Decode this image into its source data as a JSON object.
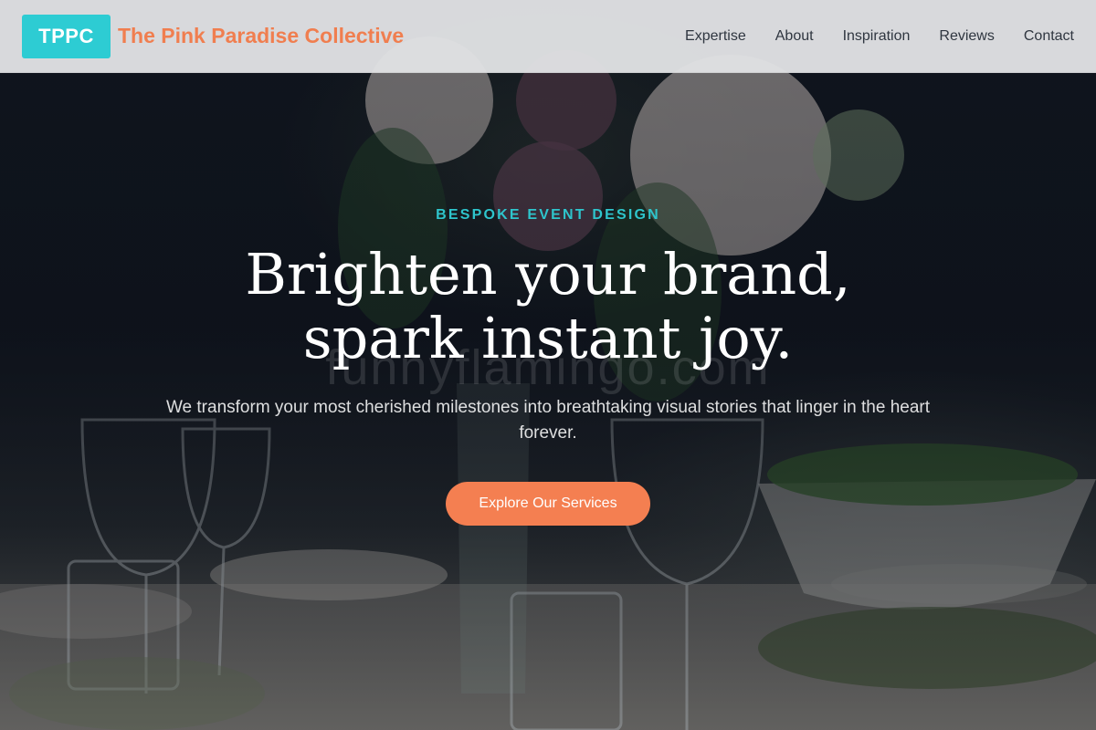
{
  "header": {
    "logo_abbr": "TPPC",
    "brand_name": "The Pink Paradise Collective",
    "nav": [
      {
        "label": "Expertise"
      },
      {
        "label": "About"
      },
      {
        "label": "Inspiration"
      },
      {
        "label": "Reviews"
      },
      {
        "label": "Contact"
      }
    ]
  },
  "hero": {
    "eyebrow": "BESPOKE EVENT DESIGN",
    "headline_line1": "Brighten your brand,",
    "headline_line2": "spark instant joy.",
    "subtext": "We transform your most cherished milestones into breathtaking visual stories that linger in the heart forever.",
    "cta_label": "Explore Our Services",
    "watermark": "funnyflamingo.com"
  },
  "colors": {
    "accent_teal": "#2dccd3",
    "accent_orange": "#f47f51",
    "header_bg": "#e1e2e4",
    "nav_text": "#2f3640"
  }
}
